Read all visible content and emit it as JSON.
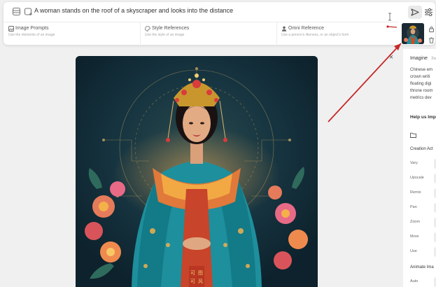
{
  "prompt": {
    "text": "A woman stands on the roof of a skyscraper and looks into the distance"
  },
  "references": [
    {
      "title": "Image Prompts",
      "subtitle": "Use the elements of an image"
    },
    {
      "title": "Style References",
      "subtitle": "Use the style of an image"
    },
    {
      "title": "Omni Reference",
      "subtitle": "Use a person's likeness, or an object's form"
    }
  ],
  "main_image": {
    "seal_text": [
      "可",
      "图",
      "可",
      "风"
    ]
  },
  "details": {
    "title": "Imagine",
    "age": "3w",
    "description": [
      "Chinese em",
      "crown writi",
      "floating digi",
      "throne room",
      "metrics dev"
    ],
    "help": "Help us Imp",
    "creation_actions_label": "Creation Act",
    "actions": [
      "Vary",
      "Upscale",
      "Remix",
      "Pan",
      "Zoom",
      "More",
      "Use"
    ],
    "animate_label": "Animate Ima",
    "animate_option": "Auto"
  },
  "colors": {
    "annotation_arrow": "#c62828",
    "image_background": "#112a34"
  }
}
